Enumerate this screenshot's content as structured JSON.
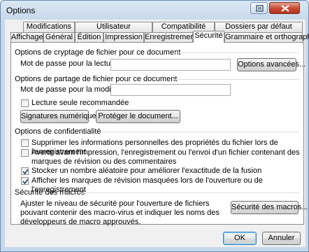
{
  "window": {
    "title": "Options"
  },
  "tabs_row1": [
    "Modifications",
    "Utilisateur",
    "Compatibilité",
    "Dossiers par défaut"
  ],
  "tabs_row2": [
    "Affichage",
    "Général",
    "Édition",
    "Impression",
    "Enregistrement",
    "Sécurité",
    "Grammaire et orthographe"
  ],
  "active_tab": "Sécurité",
  "encryption": {
    "section_title": "Options de cryptage de fichier pour ce document",
    "password_label": "Mot de passe pour la lecture :",
    "password_value": "",
    "advanced_button": "Options avancées..."
  },
  "sharing": {
    "section_title": "Options de partage de fichier pour ce document",
    "password_label": "Mot de passe pour la modification :",
    "password_value": "",
    "readonly_label": "Lecture seule recommandée",
    "readonly_checked": false,
    "signatures_button": "Signatures numériques...",
    "protect_button": "Protéger le document..."
  },
  "privacy": {
    "section_title": "Options de confidentialité",
    "options": [
      {
        "label": "Supprimer les informations personnelles des propriétés du fichier lors de l'enregistrement",
        "checked": false
      },
      {
        "label": "Avertir avant l'impression, l'enregistrement ou l'envoi d'un fichier contenant des marques de révision ou des commentaires",
        "checked": false
      },
      {
        "label": "Stocker un nombre aléatoire pour améliorer l'exactitude de la fusion",
        "checked": true
      },
      {
        "label": "Afficher les marques de révision masquées lors de l'ouverture ou de l'enregistrement",
        "checked": true
      }
    ]
  },
  "macro": {
    "section_title": "Sécurité des macros",
    "description": "Ajuster le niveau de sécurité pour l'ouverture de fichiers pouvant contenir des macro-virus et indiquer les noms des développeurs de macro approuvés.",
    "button": "Sécurité des macros..."
  },
  "footer": {
    "ok": "OK",
    "cancel": "Annuler"
  },
  "icons": [
    "help-icon",
    "close-icon"
  ]
}
